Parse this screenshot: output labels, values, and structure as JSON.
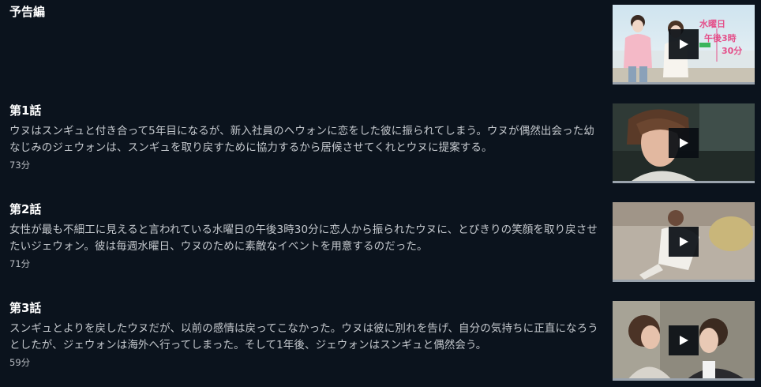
{
  "episodes": [
    {
      "title": "予告編",
      "description": "",
      "duration": "",
      "thumbnail_icon": "trailer-thumbnail",
      "thumbnail_text": [
        "水曜日",
        "午後3時",
        "30分"
      ]
    },
    {
      "title": "第1話",
      "description": "ウヌはスンギュと付き合って5年目になるが、新入社員のヘウォンに恋をした彼に振られてしまう。ウヌが偶然出会った幼なじみのジェウォンは、スンギュを取り戻すために協力するから居候させてくれとウヌに提案する。",
      "duration": "73分",
      "thumbnail_icon": "episode-1-thumbnail"
    },
    {
      "title": "第2話",
      "description": "女性が最も不細工に見えると言われている水曜日の午後3時30分に恋人から振られたウヌに、とびきりの笑顔を取り戻させたいジェウォン。彼は毎週水曜日、ウヌのために素敵なイベントを用意するのだった。",
      "duration": "71分",
      "thumbnail_icon": "episode-2-thumbnail"
    },
    {
      "title": "第3話",
      "description": "スンギュとよりを戻したウヌだが、以前の感情は戻ってこなかった。ウヌは彼に別れを告げ、自分の気持ちに正直になろうとしたが、ジェウォンは海外へ行ってしまった。そして1年後、ジェウォンはスンギュと偶然会う。",
      "duration": "59分",
      "thumbnail_icon": "episode-3-thumbnail"
    }
  ],
  "icons": {
    "play": "play-icon"
  },
  "colors": {
    "background": "#0b131d",
    "title": "#ffffff",
    "description": "#c4c8cd",
    "trailer_accent": "#e4508a"
  }
}
